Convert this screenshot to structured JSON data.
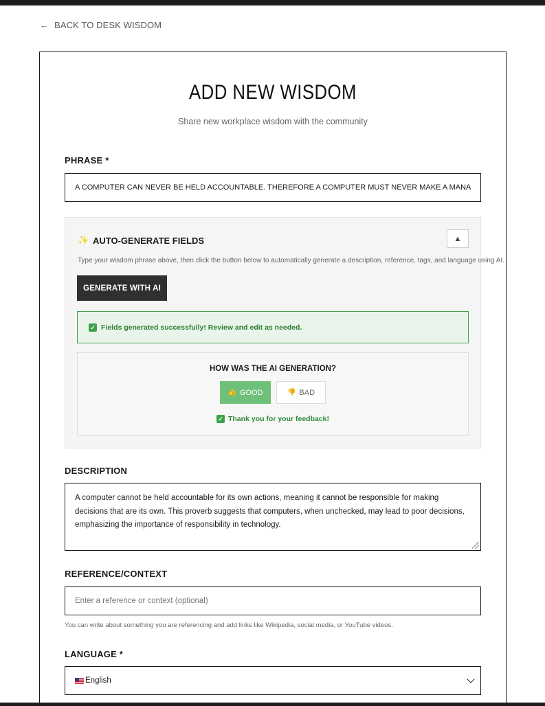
{
  "nav": {
    "back_label": "Back to Desk Wisdom"
  },
  "header": {
    "title": "ADD NEW WISDOM",
    "subtitle": "Share new workplace wisdom with the community"
  },
  "phrase": {
    "label": "PHRASE *",
    "value": "A COMPUTER CAN NEVER BE HELD ACCOUNTABLE. THEREFORE A COMPUTER MUST NEVER MAKE A MANAGEMENT DECISION"
  },
  "auto_generate": {
    "title": "AUTO-GENERATE FIELDS",
    "collapse_symbol": "▲",
    "help_text": "Type your wisdom phrase above, then click the button below to automatically generate a description, reference, tags, and language using AI.",
    "button_label": "GENERATE WITH AI",
    "success_message": "Fields generated successfully! Review and edit as needed.",
    "feedback": {
      "question": "HOW WAS THE AI GENERATION?",
      "good_label": "GOOD",
      "bad_label": "BAD",
      "thanks": "Thank you for your feedback!",
      "selected": "good"
    }
  },
  "description": {
    "label": "DESCRIPTION",
    "value": "A computer cannot be held accountable for its own actions, meaning it cannot be responsible for making decisions that are its own. This proverb suggests that computers, when unchecked, may lead to poor decisions, emphasizing the importance of responsibility in technology."
  },
  "reference": {
    "label": "REFERENCE/CONTEXT",
    "value": "",
    "placeholder": "Enter a reference or context (optional)",
    "helper": "You can write about something you are referencing and add links like Wikipedia, social media, or YouTube videos."
  },
  "language": {
    "label": "LANGUAGE *",
    "selected": "English"
  },
  "colors": {
    "primary_dark": "#2f2f2f",
    "success_green": "#3fa14a",
    "good_button": "#6fc17a",
    "success_bg": "#e9f5ea"
  },
  "icons": {
    "back": "arrow-left-icon",
    "sparkle": "sparkle-icon",
    "check": "check-icon",
    "thumbs_up": "thumbs-up-icon",
    "thumbs_down": "thumbs-down-icon",
    "flag": "us-flag-icon",
    "chevron": "chevron-down-icon"
  }
}
